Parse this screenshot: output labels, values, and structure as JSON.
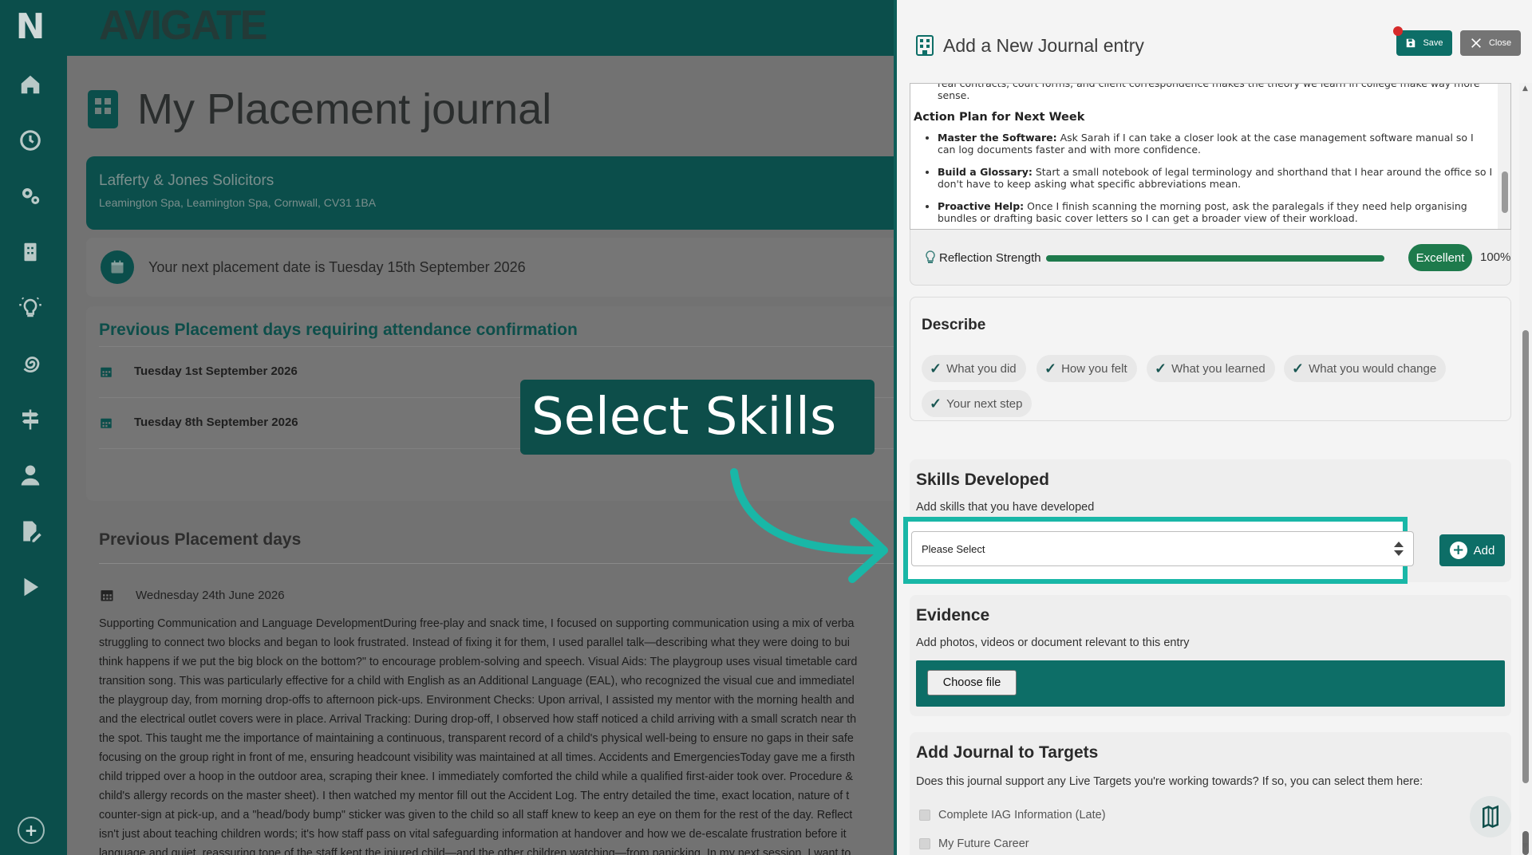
{
  "brand": {
    "name": "AVIGATE"
  },
  "nav": {
    "items": [
      {
        "icon": "home-icon"
      },
      {
        "icon": "clock-icon"
      },
      {
        "icon": "gears-icon"
      },
      {
        "icon": "building-icon"
      },
      {
        "icon": "lightbulb-icon"
      },
      {
        "icon": "spiral-icon"
      },
      {
        "icon": "signpost-icon"
      },
      {
        "icon": "user-icon"
      },
      {
        "icon": "edit-document-icon"
      },
      {
        "icon": "play-icon"
      }
    ],
    "help_icon": "plus-circle-icon"
  },
  "main": {
    "page_title": "My Placement journal",
    "placement": {
      "name": "Lafferty & Jones Solicitors",
      "address": "Leamington Spa, Leamington Spa, Cornwall, CV31 1BA"
    },
    "next_date_text": "Your next placement date is Tuesday 15th September 2026",
    "confirm_section": {
      "title": "Previous Placement days requiring attendance confirmation",
      "dates": [
        "Tuesday 1st September 2026",
        "Tuesday 8th September 2026"
      ]
    },
    "previous_days": {
      "title": "Previous Placement days",
      "entry_date": "Wednesday 24th June 2026",
      "entry_lines": [
        "Supporting Communication and Language DevelopmentDuring free-play and snack time, I focused on supporting communication using a mix of verba",
        "struggling to connect two blocks and began to look frustrated. Instead of fixing it for them, I used parallel talk—describing what they were doing to bui",
        "think happens if we put the big block on the bottom?\" to encourage problem-solving and speech. Visual Aids: The playgroup uses visual timetable card",
        "transition song. This was particularly effective for a child with English as an Additional Language (EAL), who recognized the visual cue and immediatel",
        "the playgroup day, from morning drop-offs to afternoon pick-ups. Environment Checks: Upon arrival, I assisted my mentor with the morning health and",
        "and the electrical outlet covers were in place. Arrival Tracking: During drop-off, I observed how staff noticed a child arriving with a small scratch near th",
        "the spot. This taught me the importance of maintaining a continuous, transparent record of a child's physical well-being to ensure no gaps in their safe",
        "focusing on the group right in front of me, ensuring headcount visibility was maintained at all times. Accidents and EmergenciesToday gave me a firsth",
        "child tripped over a hoop in the outdoor area, scraping their knee. I immediately comforted the child while a qualified first-aider took over. Procedure &",
        "child's allergy records on the master sheet). I then watched my mentor fill out the Accident Log. The entry detailed the time, exact location, nature of t",
        "counter-sign at pick-up, and a \"head/body bump\" sticker was given to the child so all staff knew to keep an eye on them for the rest of the day. Reflect",
        "isn't just about teaching children words; it's how staff pass on vital safeguarding information at handover and how we de-escalate frustration before it",
        "language and quiet, reassuring tone of the staff kept the injured child—and the other children watching—from panicking. In my next session, I want to"
      ]
    }
  },
  "callout": {
    "text": "Select Skills",
    "color": "#19b7a7"
  },
  "modal": {
    "title": "Add a New Journal entry",
    "save_label": "Save",
    "close_label": "Close",
    "editor": {
      "lead_text": "real contracts, court forms, and client correspondence makes the theory we learn in college make way more sense.",
      "heading": "Action Plan for Next Week",
      "bullets": [
        {
          "bold": "Master the Software:",
          "text": " Ask Sarah if I can take a closer look at the case management software manual so I can log documents faster and with more confidence."
        },
        {
          "bold": "Build a Glossary:",
          "text": " Start a small notebook of legal terminology and shorthand that I hear around the office so I don't have to keep asking what specific abbreviations mean."
        },
        {
          "bold": "Proactive Help:",
          "text": " Once I finish scanning the morning post, ask the paralegals if they need help organising bundles or drafting basic cover letters so I can get a broader view of their workload."
        }
      ]
    },
    "reflection": {
      "label": "Reflection Strength",
      "badge": "Excellent",
      "percent_text": "100%",
      "level": 1.0,
      "color": "#1e7a4c"
    },
    "describe": {
      "title": "Describe",
      "chips": [
        "What you did",
        "How you felt",
        "What you learned",
        "What you would change",
        "Your next step"
      ]
    },
    "skills": {
      "title": "Skills Developed",
      "subtitle": "Add skills that you have developed",
      "select_value": "Please Select",
      "add_label": "Add"
    },
    "evidence": {
      "title": "Evidence",
      "subtitle": "Add photos, videos or document relevant to this entry",
      "file_button": "Choose file"
    },
    "targets": {
      "title": "Add Journal to Targets",
      "subtitle": "Does this journal support any Live Targets you're working towards? If so, you can select them here:",
      "items": [
        "Complete IAG Information (Late)",
        "My Future Career"
      ]
    }
  },
  "colors": {
    "brand_dark": "#0b4e4b",
    "accent_teal": "#0d6e67",
    "highlight": "#19b7a7"
  }
}
